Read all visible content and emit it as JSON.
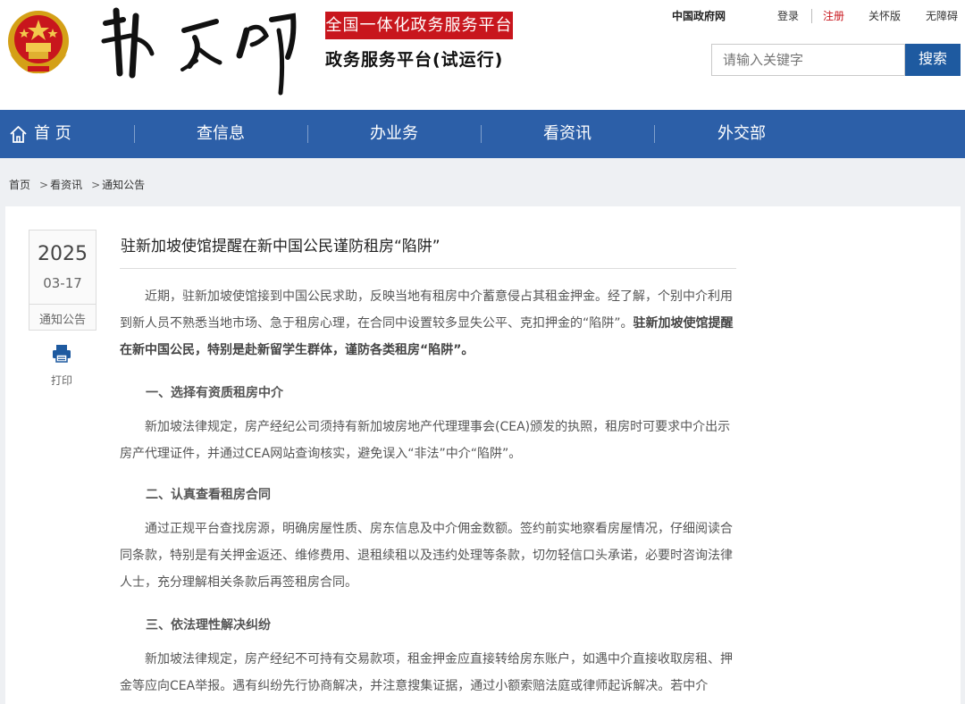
{
  "header": {
    "platform_badge": "全国一体化政务服务平台",
    "platform_title": "政务服务平台(试运行)",
    "emblem_icon": "national-emblem-icon",
    "logo_image": "ministry-calligraphy-logo",
    "top_links": {
      "gov_site": "中国政府网",
      "login": "登录",
      "register": "注册",
      "elderly_mode": "关怀版",
      "accessibility": "无障碍"
    },
    "search": {
      "placeholder": "请输入关键字",
      "button_label": "搜索"
    }
  },
  "nav": {
    "items": [
      {
        "label": "首 页",
        "icon": "home-icon"
      },
      {
        "label": "查信息"
      },
      {
        "label": "办业务"
      },
      {
        "label": "看资讯"
      },
      {
        "label": "外交部"
      }
    ]
  },
  "breadcrumb": [
    "首页",
    "看资讯",
    "通知公告"
  ],
  "article": {
    "date_year": "2025",
    "date_md": "03-17",
    "category": "通知公告",
    "print_label": "打印",
    "title": "驻新加坡使馆提醒在新中国公民谨防租房“陷阱”",
    "intro_normal": "近期，驻新加坡使馆接到中国公民求助，反映当地有租房中介蓄意侵占其租金押金。经了解，个别中介利用到新人员不熟悉当地市场、急于租房心理，在合同中设置较多显失公平、克扣押金的“陷阱”。",
    "intro_strong": "驻新加坡使馆提醒在新中国公民，特别是赴新留学生群体，谨防各类租房“陷阱”。",
    "section1_title": "一、选择有资质租房中介",
    "section1_body": "新加坡法律规定，房产经纪公司须持有新加坡房地产代理理事会(CEA)颁发的执照，租房时可要求中介出示房产代理证件，并通过CEA网站查询核实，避免误入“非法”中介“陷阱”。",
    "section2_title": "二、认真查看租房合同",
    "section2_body": "通过正规平台查找房源，明确房屋性质、房东信息及中介佣金数额。签约前实地察看房屋情况，仔细阅读合同条款，特别是有关押金返还、维修费用、退租续租以及违约处理等条款，切勿轻信口头承诺，必要时咨询法律人士，充分理解相关条款后再签租房合同。",
    "section3_title": "三、依法理性解决纠纷",
    "section3_body": "新加坡法律规定，房产经纪不可持有交易款项，租金押金应直接转给房东账户，如遇中介直接收取房租、押金等应向CEA举报。遇有纠纷先行协商解决，并注意搜集证据，通过小额索赔法庭或律师起诉解决。若中介"
  },
  "colors": {
    "nav_blue": "#2c5fa8",
    "badge_red": "#c8161d",
    "search_button": "#1e5aa0",
    "register_red": "#c8161d"
  }
}
